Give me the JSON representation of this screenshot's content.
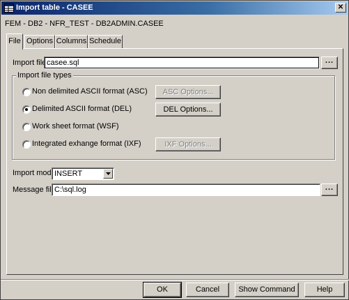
{
  "window": {
    "title": "Import table - CASEE",
    "close_label": "✕",
    "subtitle": "FEM - DB2 - NFR_TEST - DB2ADMIN.CASEE"
  },
  "tabs": [
    {
      "label": "File",
      "active": true
    },
    {
      "label": "Options",
      "active": false
    },
    {
      "label": "Columns",
      "active": false
    },
    {
      "label": "Schedule",
      "active": false
    }
  ],
  "import_file": {
    "label": "Import file",
    "value": "casee.sql",
    "browse_label": "..."
  },
  "file_types": {
    "title": "Import file types",
    "options": [
      {
        "label": "Non delimited ASCII format (ASC)",
        "selected": false,
        "button": "ASC Options...",
        "button_enabled": false
      },
      {
        "label": "Delimited ASCII format (DEL)",
        "selected": true,
        "button": "DEL Options...",
        "button_enabled": true
      },
      {
        "label": "Work sheet format (WSF)",
        "selected": false
      },
      {
        "label": "Integrated exhange format (IXF)",
        "selected": false,
        "button": "IXF Options...",
        "button_enabled": false
      }
    ]
  },
  "import_mode": {
    "label": "Import mode",
    "value": "INSERT"
  },
  "message_file": {
    "label": "Message file",
    "value": "C:\\sql.log",
    "browse_label": "..."
  },
  "buttons": {
    "ok": "OK",
    "cancel": "Cancel",
    "show_command": "Show Command",
    "help": "Help"
  }
}
